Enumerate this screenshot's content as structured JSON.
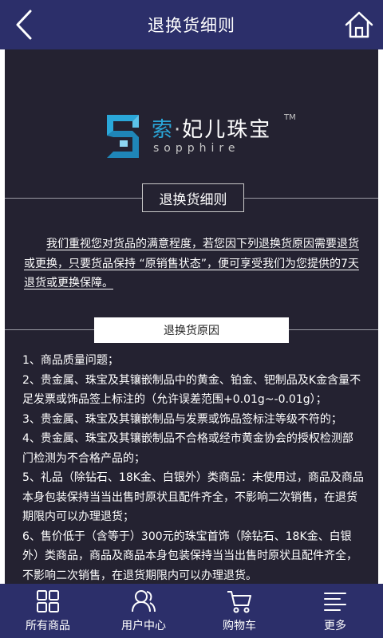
{
  "header": {
    "title": "退换货细则"
  },
  "logo": {
    "brand_cn_1": "索",
    "brand_dot": "·",
    "brand_cn_2": "妃儿珠宝",
    "brand_en": "sopphire",
    "tm": "TM"
  },
  "section": {
    "title": "退换货细则",
    "intro": "我们重视您对货品的满意程度，若您因下列退换货原因需要退货或更换，只要货品保持 “原销售状态”，便可享受我们为您提供的7天退货或更换保障。",
    "reason_title": "退换货原因",
    "reasons": [
      "1、商品质量问题；",
      "2、贵金属、珠宝及其镶嵌制品中的黄金、铂金、钯制品及K金含量不足发票或饰品签上标注的（允许误差范围+0.01g~-0.01g）；",
      "3、贵金属、珠宝及其镶嵌制品与发票或饰品签标注等级不符的；",
      "4、贵金属、珠宝及其镶嵌制品不合格或经市黄金协会的授权检测部门检测为不合格产品的；",
      "5、礼品（除钻石、18K金、白银外）类商品：未使用过，商品及商品本身包装保持当当出售时原状且配件齐全，不影响二次销售，在退货期限内可以办理退货；",
      "6、售价低于（含等于）300元的珠宝首饰（除钻石、18K金、白银外）类商品，商品及商品本身包装保持当当出售时原状且配件齐全，不影响二次销售，在退货期限内可以办理退货。"
    ]
  },
  "tabbar": {
    "items": [
      {
        "label": "所有商品",
        "icon": "grid-icon"
      },
      {
        "label": "用户中心",
        "icon": "user-icon"
      },
      {
        "label": "购物车",
        "icon": "cart-icon"
      },
      {
        "label": "更多",
        "icon": "menu-icon"
      }
    ]
  },
  "colors": {
    "header_bg": "#2c2f6a",
    "content_bg": "#242231",
    "logo_blue": "#2aa7d9"
  }
}
